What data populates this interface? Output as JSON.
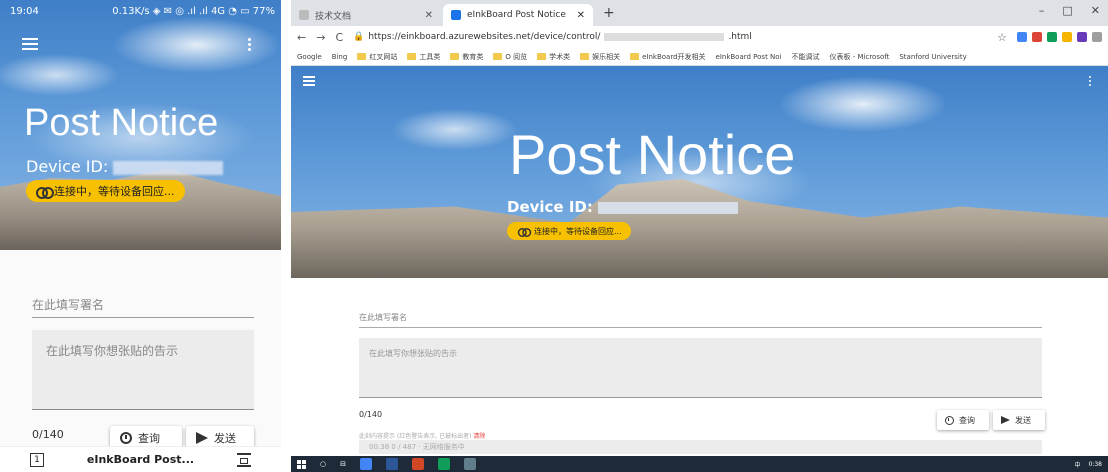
{
  "phone": {
    "status": {
      "time": "19:04",
      "indicators": "0.13K/s ◈ ✉ ◎ .ıl .ıl 4G ◔ ▭ 77%"
    },
    "title": "Post Notice",
    "device_label": "Device ID:",
    "status_pill": "连接中，等待设备回应...",
    "signature_placeholder": "在此填写署名",
    "notice_placeholder": "在此填写你想张贴的告示",
    "count": "0/140",
    "query_button": "查询",
    "send_button": "发送",
    "bottom_bar": {
      "tab_count": "1",
      "page_title": "eInkBoard Post..."
    }
  },
  "browser": {
    "tabs": [
      {
        "label": "技术文档"
      },
      {
        "label": "eInkBoard Post Notice"
      }
    ],
    "new_tab": "+",
    "window_controls": {
      "minimize": "–",
      "maximize": "□",
      "close": "✕"
    },
    "address": {
      "url_prefix": "https://einkboard.azurewebsites.net/device/control/",
      "url_suffix": ".html"
    },
    "bookmarks": [
      "Google",
      "Bing",
      "红叉网站",
      "工具类",
      "教育类",
      "O 阅览",
      "学术类",
      "娱乐相关",
      "eInkBoard开发相关",
      "eInkBoard Post Noi",
      "不能调试",
      "仪表板 - Microsoft",
      "Stanford University"
    ]
  },
  "page": {
    "title": "Post Notice",
    "device_label": "Device ID:",
    "status_pill": "连接中，等待设备回应...",
    "signature_placeholder": "在此填写署名",
    "notice_placeholder": "在此填写你想张贴的告示",
    "count": "0/140",
    "hint_prefix": "此刻内容提示 (红色警告表示, 已被标出者)",
    "hint_link": "清除",
    "tip": "00:38 0 / 487 · 无网络服务中",
    "query_button": "查询",
    "send_button": "发送"
  },
  "taskbar": {
    "clock": "0:38",
    "lang": "中"
  },
  "colors": {
    "accent_yellow": "#f7c000",
    "sky": "#4a86cc"
  }
}
